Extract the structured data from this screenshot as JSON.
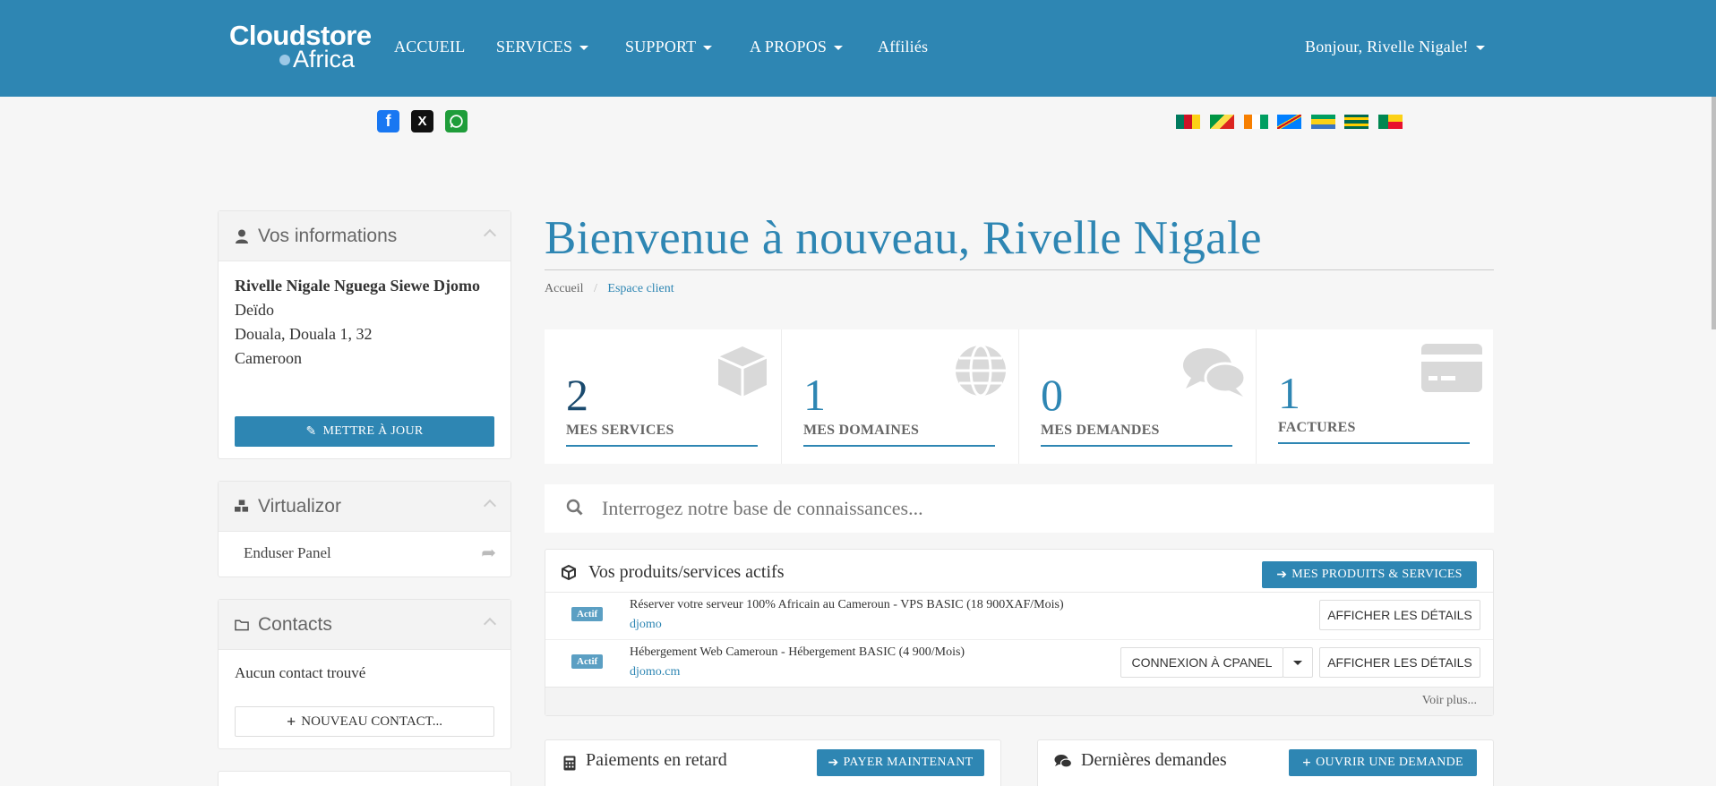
{
  "brand": {
    "line1": "Cloudstore",
    "line2": "Africa"
  },
  "nav": {
    "home": "ACCUEIL",
    "services": "SERVICES",
    "support": "SUPPORT",
    "about": "A PROPOS",
    "affiliates": "Affiliés",
    "greeting": "Bonjour, Rivelle Nigale!"
  },
  "social": [
    "facebook-icon",
    "x-icon",
    "whatsapp-icon"
  ],
  "flags": [
    "cameroon",
    "congo",
    "ivory-coast",
    "dr-congo",
    "gabon",
    "togo",
    "benin"
  ],
  "sidebar": {
    "info": {
      "title": "Vos informations",
      "name": "Rivelle Nigale Nguega Siewe Djomo",
      "addr1": "Deïdo",
      "addr2": "Douala, Douala 1, 32",
      "country": "Cameroon",
      "update_btn": "METTRE À JOUR"
    },
    "virtualizor": {
      "title": "Virtualizor",
      "item": "Enduser Panel"
    },
    "contacts": {
      "title": "Contacts",
      "empty": "Aucun contact trouvé",
      "new_btn": "NOUVEAU CONTACT..."
    }
  },
  "main": {
    "title": "Bienvenue à nouveau, Rivelle Nigale",
    "breadcrumb": {
      "home": "Accueil",
      "sep": "/",
      "current": "Espace client"
    },
    "stats": [
      {
        "value": "2",
        "label": "MES SERVICES",
        "icon": "cube-icon"
      },
      {
        "value": "1",
        "label": "MES DOMAINES",
        "icon": "globe-icon"
      },
      {
        "value": "0",
        "label": "MES DEMANDES",
        "icon": "comments-icon"
      },
      {
        "value": "1",
        "label": "FACTURES",
        "icon": "credit-card-icon"
      }
    ],
    "search_placeholder": "Interrogez notre base de connaissances...",
    "products": {
      "title": "Vos produits/services actifs",
      "btn": "MES PRODUITS & SERVICES",
      "rows": [
        {
          "status": "Actif",
          "name": "Réserver votre serveur 100% Africain au Cameroun - VPS BASIC (18 900XAF/Mois)",
          "domain": "djomo",
          "details_btn": "AFFICHER LES DÉTAILS"
        },
        {
          "status": "Actif",
          "name": "Hébergement Web Cameroun - Hébergement BASIC (4 900/Mois)",
          "domain": "djomo.cm",
          "cpanel_btn": "CONNEXION À CPANEL",
          "details_btn": "AFFICHER LES DÉTAILS"
        }
      ],
      "more": "Voir plus..."
    },
    "payments": {
      "title": "Paiements en retard",
      "btn": "PAYER MAINTENANT"
    },
    "tickets": {
      "title": "Dernières demandes",
      "btn": "OUVRIR UNE DEMANDE"
    }
  },
  "colors": {
    "primary": "#2e86b3",
    "background": "#f6f6f6"
  }
}
